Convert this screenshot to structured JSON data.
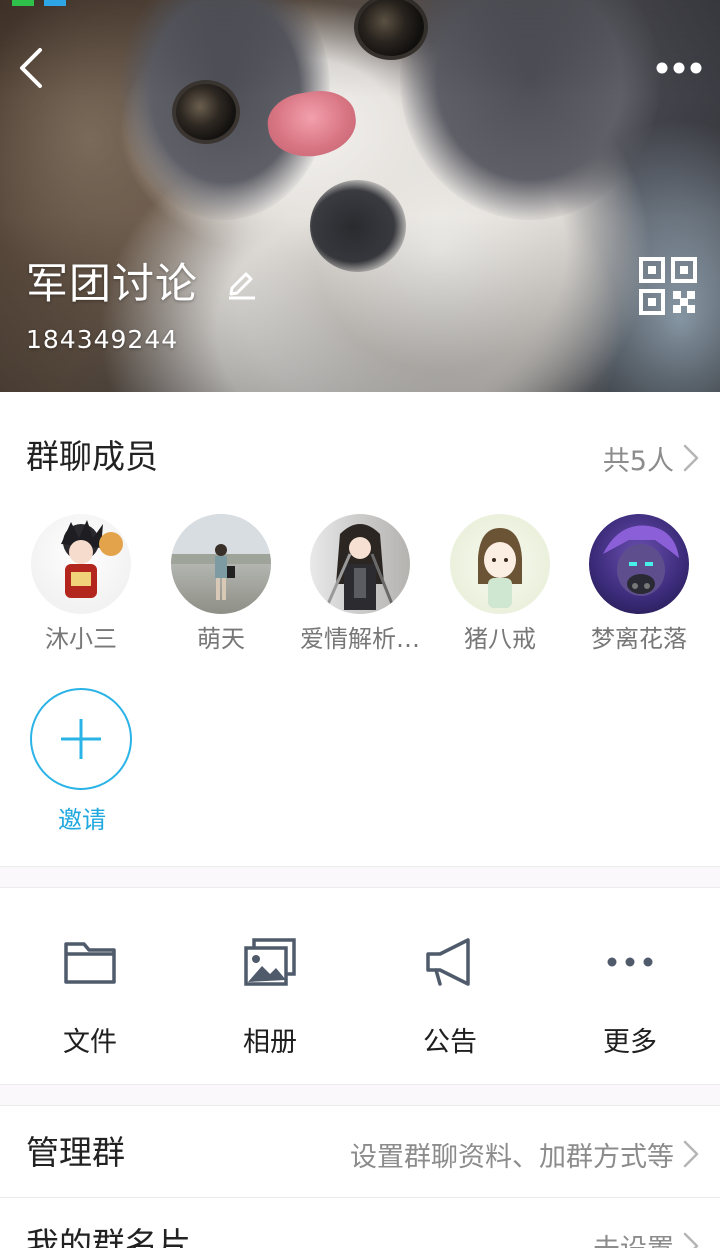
{
  "header": {
    "group_name": "军团讨论",
    "group_id": "184349244",
    "icons": {
      "back": "chevron-left-icon",
      "more": "more-dots-icon",
      "edit": "pencil-icon",
      "qr": "qr-code-icon"
    }
  },
  "members": {
    "title": "群聊成员",
    "count_label": "共5人",
    "list": [
      {
        "name": "沐小三"
      },
      {
        "name": "萌天"
      },
      {
        "name": "爱情解析…"
      },
      {
        "name": "猪八戒"
      },
      {
        "name": "梦离花落"
      }
    ],
    "invite_label": "邀请"
  },
  "actions": [
    {
      "label": "文件",
      "icon": "folder-icon"
    },
    {
      "label": "相册",
      "icon": "album-icon"
    },
    {
      "label": "公告",
      "icon": "megaphone-icon"
    },
    {
      "label": "更多",
      "icon": "more-horizontal-icon"
    }
  ],
  "rows": {
    "manage": {
      "title": "管理群",
      "value": "设置群聊资料、加群方式等"
    },
    "card": {
      "title": "我的群名片",
      "value": "未设置"
    }
  },
  "colors": {
    "accent": "#1fa7df",
    "secondary_text": "#8c8c8c",
    "icon_gray": "#4f5a6b"
  }
}
